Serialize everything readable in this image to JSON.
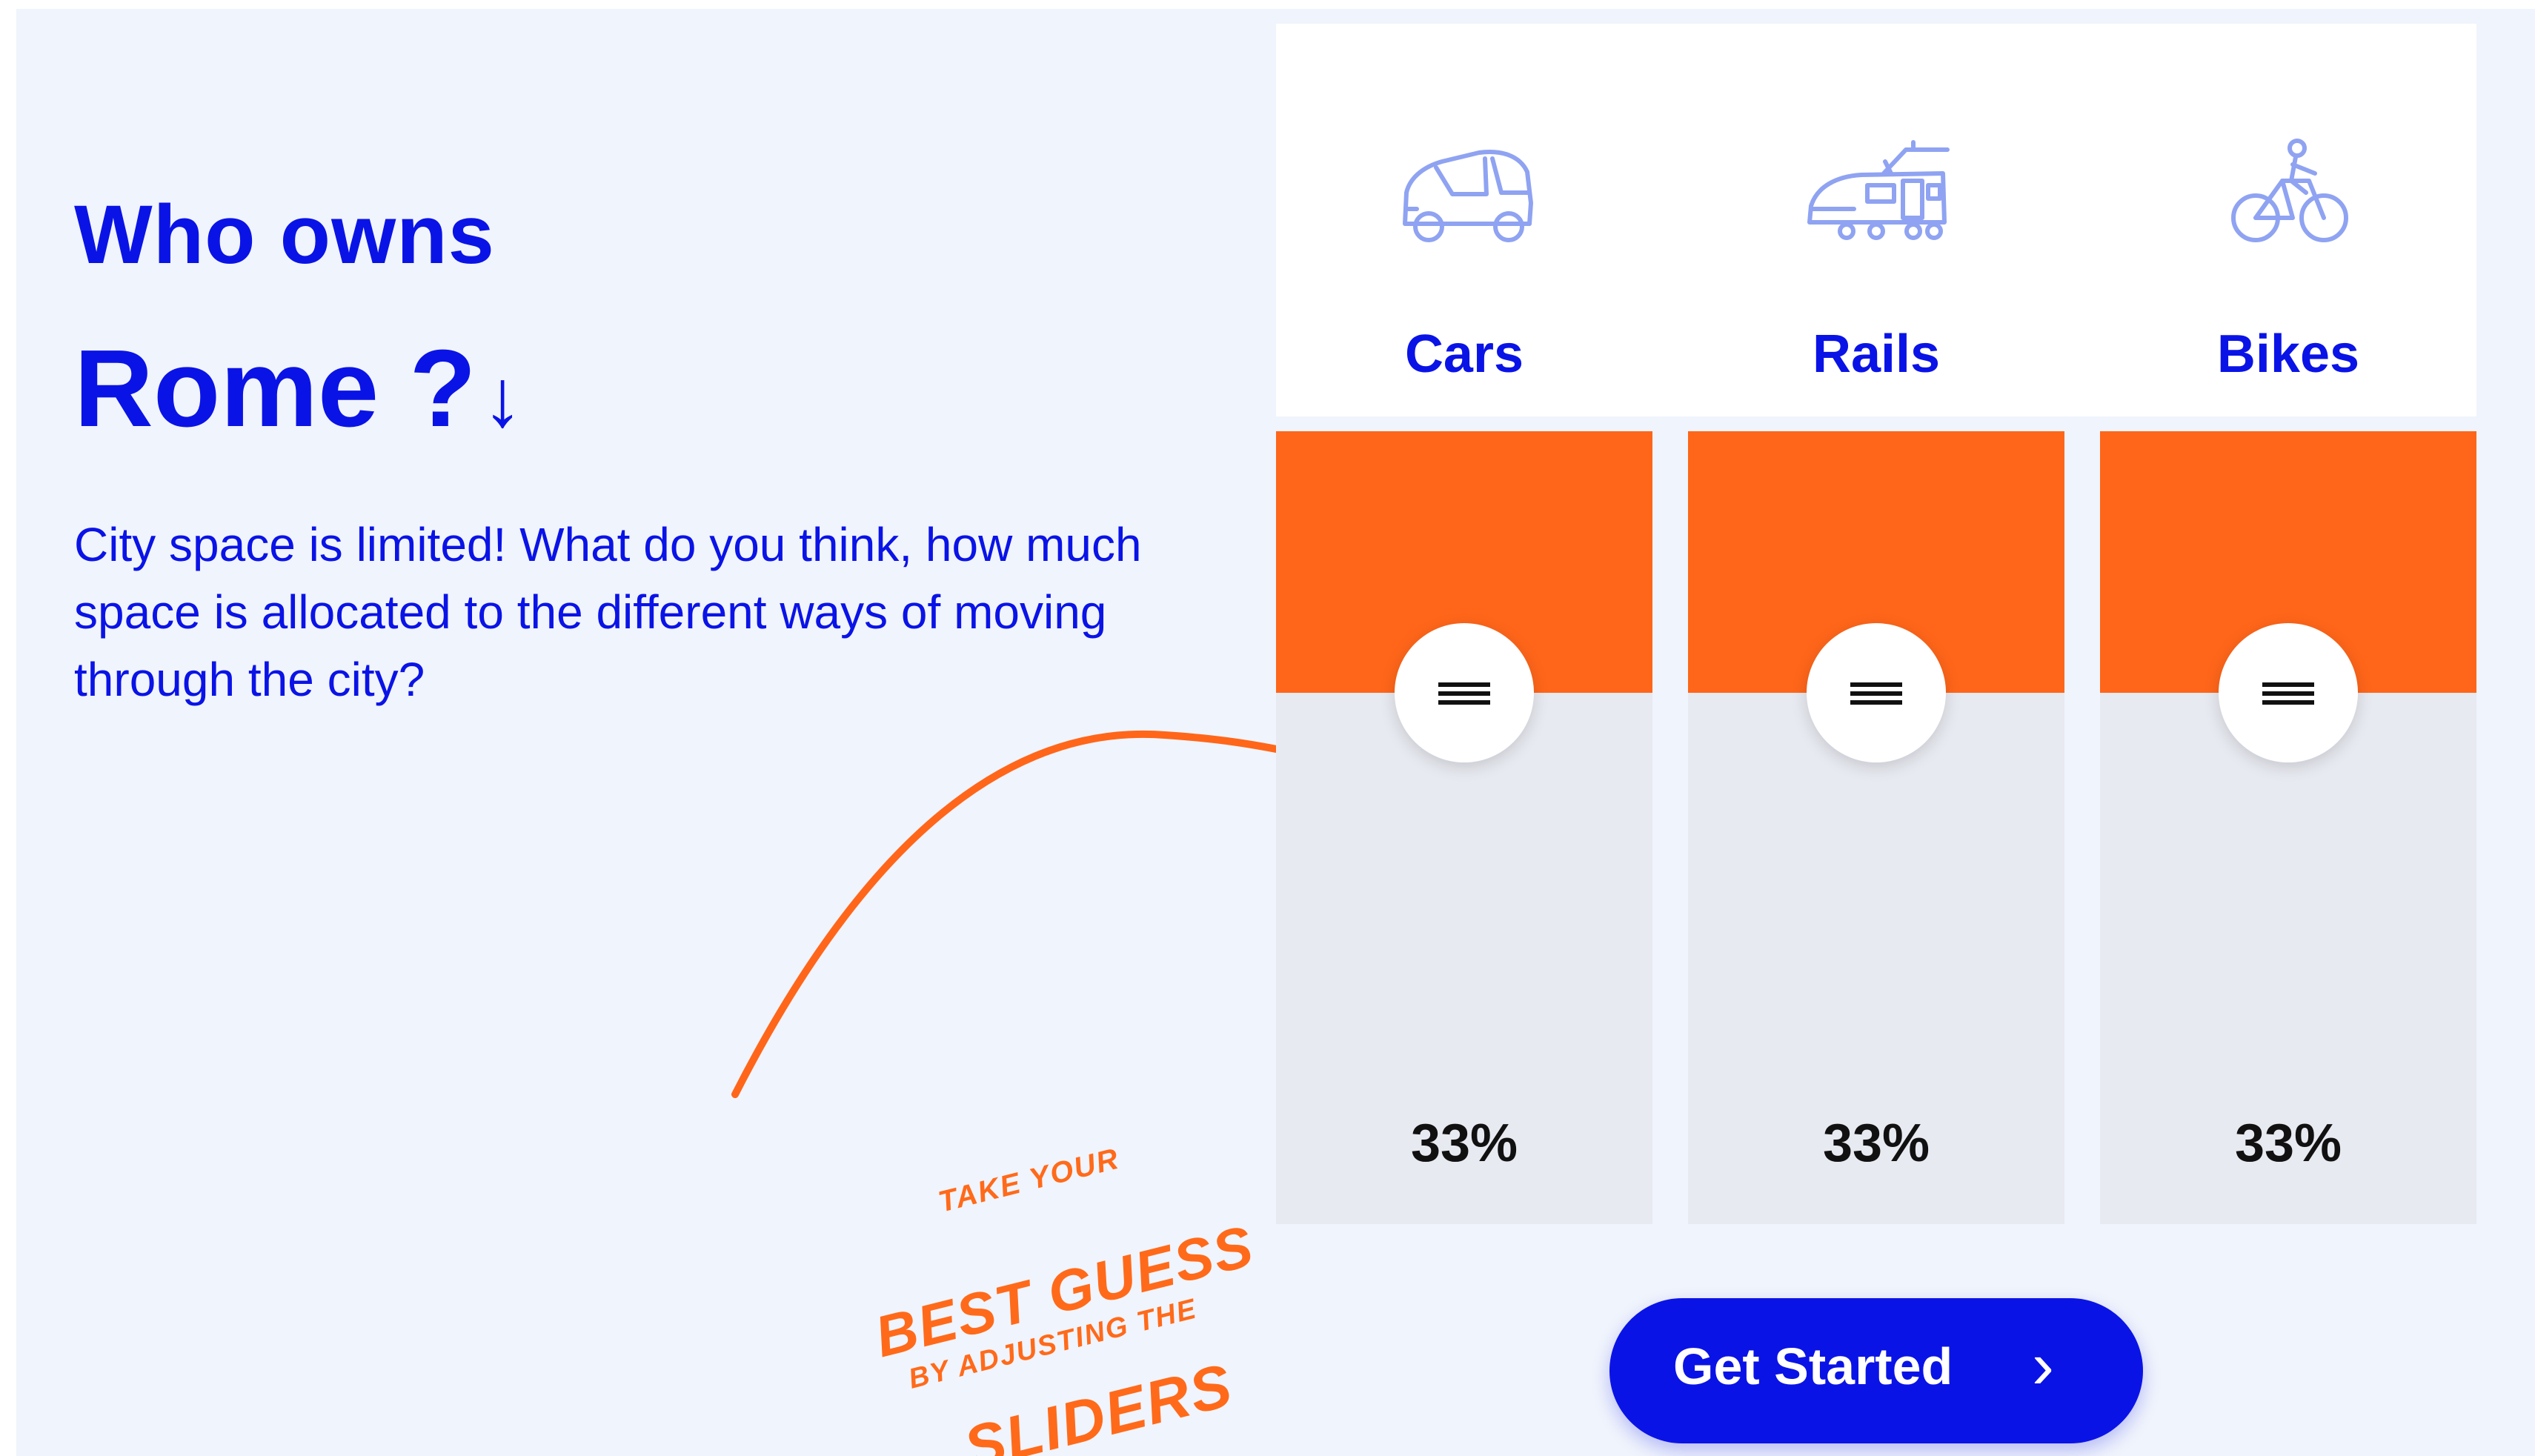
{
  "heading": {
    "kicker": "Who owns",
    "city": "Rome ?",
    "arrow": "↓"
  },
  "description": "City space is limited! What do you think, how much space is allocated to the different ways of moving through the city?",
  "hint": {
    "line1": "TAKE YOUR",
    "line2": "BEST GUESS",
    "line3": "BY ADJUSTING THE",
    "line4": "SLIDERS"
  },
  "sliders": [
    {
      "label": "Cars",
      "icon": "car-icon",
      "value": 33,
      "display": "33%"
    },
    {
      "label": "Rails",
      "icon": "tram-icon",
      "value": 33,
      "display": "33%"
    },
    {
      "label": "Bikes",
      "icon": "bicycle-icon",
      "value": 33,
      "display": "33%"
    }
  ],
  "cta": {
    "label": "Get Started",
    "chevron": "›"
  },
  "colors": {
    "blue": "#0a13e6",
    "orange": "#ff661a",
    "icon_blue": "#8fa3f2",
    "track": "#e8eaf1",
    "background": "#f0f4fc"
  }
}
